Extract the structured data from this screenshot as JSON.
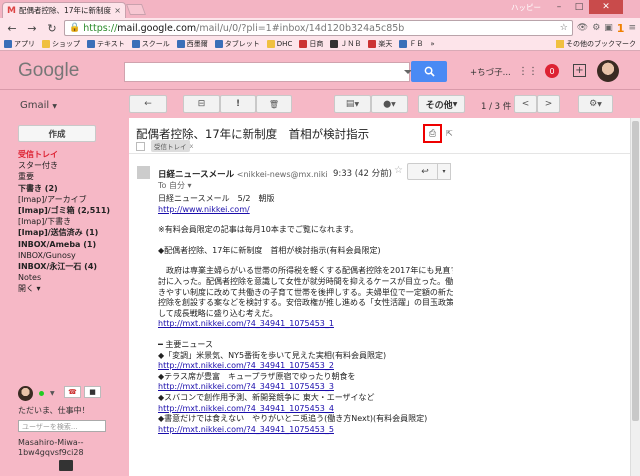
{
  "browser": {
    "tab_title": "配偶者控除、17年に新制度",
    "tab_close": "×",
    "profile_name": "ハッピー",
    "url_secure": "https://",
    "url_host": "mail.google.com",
    "url_path": "/mail/u/0/?pli=1#inbox/14d120b324a5c85b",
    "ext_badge": "1",
    "win_min": "–",
    "win_max": "□",
    "win_close": "✕",
    "bookmarks": [
      {
        "label": "アプリ"
      },
      {
        "label": "ショップ"
      },
      {
        "label": "テキスト"
      },
      {
        "label": "スクール"
      },
      {
        "label": "西墨爾"
      },
      {
        "label": "タブレット"
      },
      {
        "label": "DHC"
      },
      {
        "label": "日商"
      },
      {
        "label": "ＪＮＢ"
      },
      {
        "label": "楽天"
      },
      {
        "label": "ＦＢ"
      }
    ],
    "other_bookmarks": "その他のブックマーク",
    "more_bm": "»"
  },
  "gmail": {
    "logo": "Google",
    "user_short": "+ちづ子...",
    "notif_count": "0",
    "app_label": "Gmail",
    "toolbar": {
      "back": "←",
      "archive": "⊟",
      "spam": "!",
      "delete": "🗑",
      "folder": "▤",
      "labels": "⬤",
      "more": "その他",
      "pager": "1 / 3 件",
      "prev": "<",
      "next": ">",
      "settings": "⚙"
    },
    "compose": "作成",
    "labels": [
      {
        "text": "受信トレイ",
        "style": "red"
      },
      {
        "text": "スター付き",
        "style": ""
      },
      {
        "text": "重要",
        "style": ""
      },
      {
        "text": "下書き (2)",
        "style": "b"
      },
      {
        "text": "[Imap]/アーカイブ",
        "style": ""
      },
      {
        "text": "[Imap]/ゴミ箱 (2,511)",
        "style": "b"
      },
      {
        "text": "[Imap]/下書き",
        "style": ""
      },
      {
        "text": "[Imap]/送信済み (1)",
        "style": "b"
      },
      {
        "text": "INBOX/Ameba (1)",
        "style": "b"
      },
      {
        "text": "INBOX/Gunosy",
        "style": ""
      },
      {
        "text": "INBOX/永江一石 (4)",
        "style": "b"
      },
      {
        "text": "Notes",
        "style": ""
      },
      {
        "text": "開く ▾",
        "style": ""
      }
    ],
    "chat": {
      "status_msg": "ただいま、仕事中！",
      "search_placeholder": "ユーザーを検索...",
      "contact_line1": "Masahiro-Miwa--",
      "contact_line2": "1bw4gqvsf9ci28"
    }
  },
  "message": {
    "subject": "配偶者控除、17年に新制度　首相が検討指示",
    "tag": "受信トレイ",
    "tag_x": "x",
    "sender_name": "日経ニュースメール",
    "sender_email": "<nikkei-news@mx.niki",
    "to_line": "To 自分 ▾",
    "time": "9:33 (42 分前)",
    "star": "☆",
    "reply": "↩",
    "more": "▾",
    "print_icon": "⎙",
    "newwin_icon": "⇱",
    "body": [
      {
        "text": "日経ニュースメール　5/2　朝版",
        "link": false
      },
      {
        "text": "http://www.nikkei.com/",
        "link": true
      },
      {
        "text": "",
        "link": false
      },
      {
        "text": "※有料会員限定の記事は毎月10本までご覧になれます。",
        "link": false
      },
      {
        "text": "",
        "link": false
      },
      {
        "text": "◆配偶者控除、17年に新制度　首相が検討指示(有料会員限定)",
        "link": false
      },
      {
        "text": "",
        "link": false
      },
      {
        "text": "　政府は専業主婦らがいる世帯の所得税を軽くする配偶者控除を2017年にも見直す検",
        "link": false
      },
      {
        "text": "討に入った。配偶者控除を意識して女性が就労時間を抑えるケースが目立った。働",
        "link": false
      },
      {
        "text": "きやすい制度に改めて共働きの子育て世帯を後押しする。夫婦単位で一定額の新たな",
        "link": false
      },
      {
        "text": "控除を創設する案などを検討する。安倍政権が推し進める「女性活躍」の目玉政策と",
        "link": false
      },
      {
        "text": "して成長戦略に盛り込む考えだ。",
        "link": false
      },
      {
        "text": "http://mxt.nikkei.com/?4_34941_1075453_1",
        "link": true
      },
      {
        "text": "",
        "link": false
      },
      {
        "text": "━ 主要ニュース",
        "link": false
      },
      {
        "text": "◆「変調」米景気、NY5番街を歩いて見えた実相(有料会員限定)",
        "link": false
      },
      {
        "text": "http://mxt.nikkei.com/?4_34941_1075453_2",
        "link": true
      },
      {
        "text": "◆テラス席が豊富　キュープラザ原宿でゆったり朝食を",
        "link": false
      },
      {
        "text": "http://mxt.nikkei.com/?4_34941_1075453_3",
        "link": true
      },
      {
        "text": "◆スバコンで創作用予測、新開発競争に 東大・エーザイなど",
        "link": false
      },
      {
        "text": "http://mxt.nikkei.com/?4_34941_1075453_4",
        "link": true
      },
      {
        "text": "◆書意だけでは食えない　やりがいと二兎追う(働き方Next)(有料会員限定)",
        "link": false
      },
      {
        "text": "http://mxt.nikkei.com/?4_34941_1075453_5",
        "link": true
      }
    ]
  }
}
